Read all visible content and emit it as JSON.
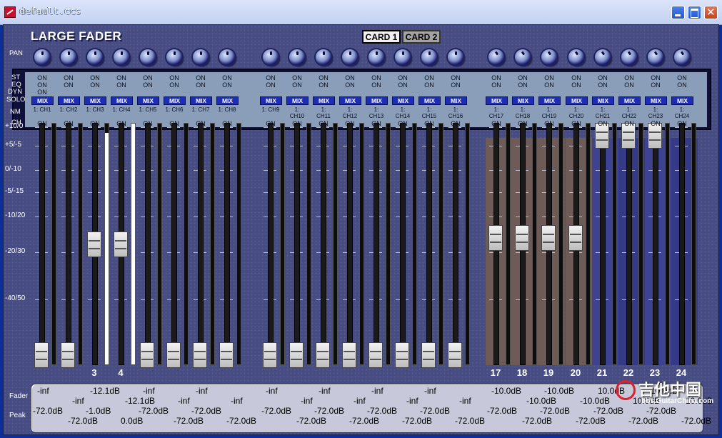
{
  "window": {
    "title": "default.ccs",
    "app_title": "LARGE FADER",
    "cards": [
      {
        "label": "CARD 1",
        "active": true
      },
      {
        "label": "CARD 2",
        "active": false
      }
    ]
  },
  "row_labels": {
    "pan": "PAN",
    "st": "ST",
    "eq": "EQ",
    "dyn": "DYN",
    "solo": "SOLO",
    "nm": "NM",
    "ch": "CH",
    "fader": "Fader",
    "peak": "Peak"
  },
  "scale_labels": [
    "+10/0",
    "+5/-5",
    "0/-10",
    "-5/-15",
    "-10/20",
    "-20/30",
    "-40/50"
  ],
  "channels": [
    {
      "st": "ON",
      "eq": "ON",
      "dyn": "ON",
      "solo": "MIX",
      "nm1": "1: CH1",
      "nm2": "",
      "ch": "ON",
      "num": "",
      "fader_level": 0.03,
      "meter": 0,
      "bg": "none",
      "fader": "-inf",
      "peak": "-72.0dB"
    },
    {
      "st": "ON",
      "eq": "ON",
      "dyn": "",
      "solo": "MIX",
      "nm1": "1: CH2",
      "nm2": "",
      "ch": "ON",
      "num": "",
      "fader_level": 0.03,
      "meter": 0,
      "bg": "none",
      "fader": "-inf",
      "peak": "-72.0dB"
    },
    {
      "st": "ON",
      "eq": "ON",
      "dyn": "",
      "solo": "MIX",
      "nm1": "1: CH3",
      "nm2": "",
      "ch": "ON",
      "num": "3",
      "fader_level": 0.52,
      "meter": 0.96,
      "bg": "none",
      "fader": "-12.1dB",
      "peak": "-1.0dB"
    },
    {
      "st": "ON",
      "eq": "ON",
      "dyn": "",
      "solo": "MIX",
      "nm1": "1: CH4",
      "nm2": "",
      "ch": "ON",
      "num": "4",
      "fader_level": 0.52,
      "meter": 1.0,
      "bg": "none",
      "fader": "-12.1dB",
      "peak": "0.0dB"
    },
    {
      "st": "ON",
      "eq": "ON",
      "dyn": "",
      "solo": "MIX",
      "nm1": "1: CH5",
      "nm2": "",
      "ch": "ON",
      "num": "",
      "fader_level": 0.03,
      "meter": 0,
      "bg": "none",
      "fader": "-inf",
      "peak": "-72.0dB"
    },
    {
      "st": "ON",
      "eq": "ON",
      "dyn": "",
      "solo": "MIX",
      "nm1": "1: CH6",
      "nm2": "",
      "ch": "ON",
      "num": "",
      "fader_level": 0.03,
      "meter": 0,
      "bg": "none",
      "fader": "-inf",
      "peak": "-72.0dB"
    },
    {
      "st": "ON",
      "eq": "ON",
      "dyn": "",
      "solo": "MIX",
      "nm1": "1: CH7",
      "nm2": "",
      "ch": "ON",
      "num": "",
      "fader_level": 0.03,
      "meter": 0,
      "bg": "none",
      "fader": "-inf",
      "peak": "-72.0dB"
    },
    {
      "st": "ON",
      "eq": "ON",
      "dyn": "",
      "solo": "MIX",
      "nm1": "1: CH8",
      "nm2": "",
      "ch": "ON",
      "num": "",
      "fader_level": 0.03,
      "meter": 0,
      "bg": "none",
      "fader": "-inf",
      "peak": "-72.0dB"
    },
    {
      "st": "ON",
      "eq": "ON",
      "dyn": "",
      "solo": "MIX",
      "nm1": "1: CH9",
      "nm2": "",
      "ch": "ON",
      "num": "",
      "fader_level": 0.03,
      "meter": 0,
      "bg": "none",
      "fader": "-inf",
      "peak": "-72.0dB"
    },
    {
      "st": "ON",
      "eq": "ON",
      "dyn": "",
      "solo": "MIX",
      "nm1": "1:",
      "nm2": "CH10",
      "ch": "ON",
      "num": "",
      "fader_level": 0.03,
      "meter": 0,
      "bg": "none",
      "fader": "-inf",
      "peak": "-72.0dB"
    },
    {
      "st": "ON",
      "eq": "ON",
      "dyn": "",
      "solo": "MIX",
      "nm1": "1:",
      "nm2": "CH11",
      "ch": "ON",
      "num": "",
      "fader_level": 0.03,
      "meter": 0,
      "bg": "none",
      "fader": "-inf",
      "peak": "-72.0dB"
    },
    {
      "st": "ON",
      "eq": "ON",
      "dyn": "",
      "solo": "MIX",
      "nm1": "1:",
      "nm2": "CH12",
      "ch": "ON",
      "num": "",
      "fader_level": 0.03,
      "meter": 0,
      "bg": "none",
      "fader": "-inf",
      "peak": "-72.0dB"
    },
    {
      "st": "ON",
      "eq": "ON",
      "dyn": "",
      "solo": "MIX",
      "nm1": "1:",
      "nm2": "CH13",
      "ch": "ON",
      "num": "",
      "fader_level": 0.03,
      "meter": 0,
      "bg": "none",
      "fader": "-inf",
      "peak": "-72.0dB"
    },
    {
      "st": "ON",
      "eq": "ON",
      "dyn": "",
      "solo": "MIX",
      "nm1": "1:",
      "nm2": "CH14",
      "ch": "ON",
      "num": "",
      "fader_level": 0.03,
      "meter": 0,
      "bg": "none",
      "fader": "-inf",
      "peak": "-72.0dB"
    },
    {
      "st": "ON",
      "eq": "ON",
      "dyn": "",
      "solo": "MIX",
      "nm1": "1:",
      "nm2": "CH15",
      "ch": "ON",
      "num": "",
      "fader_level": 0.03,
      "meter": 0,
      "bg": "none",
      "fader": "-inf",
      "peak": "-72.0dB"
    },
    {
      "st": "ON",
      "eq": "ON",
      "dyn": "",
      "solo": "MIX",
      "nm1": "1:",
      "nm2": "CH16",
      "ch": "ON",
      "num": "",
      "fader_level": 0.03,
      "meter": 0,
      "bg": "none",
      "fader": "-inf",
      "peak": "-72.0dB"
    },
    {
      "st": "ON",
      "eq": "ON",
      "dyn": "",
      "solo": "MIX",
      "nm1": "1:",
      "nm2": "CH17",
      "ch": "ON",
      "num": "17",
      "fader_level": 0.55,
      "meter": 0,
      "bg": "brown",
      "fader": "-10.0dB",
      "peak": "-72.0dB"
    },
    {
      "st": "ON",
      "eq": "ON",
      "dyn": "",
      "solo": "MIX",
      "nm1": "1:",
      "nm2": "CH18",
      "ch": "ON",
      "num": "18",
      "fader_level": 0.55,
      "meter": 0,
      "bg": "brown",
      "fader": "-10.0dB",
      "peak": "-72.0dB"
    },
    {
      "st": "ON",
      "eq": "ON",
      "dyn": "",
      "solo": "MIX",
      "nm1": "1:",
      "nm2": "CH19",
      "ch": "ON",
      "num": "19",
      "fader_level": 0.55,
      "meter": 0,
      "bg": "brown",
      "fader": "-10.0dB",
      "peak": "-72.0dB"
    },
    {
      "st": "ON",
      "eq": "ON",
      "dyn": "",
      "solo": "MIX",
      "nm1": "1:",
      "nm2": "CH20",
      "ch": "ON",
      "num": "20",
      "fader_level": 0.55,
      "meter": 0,
      "bg": "brown",
      "fader": "-10.0dB",
      "peak": "-72.0dB"
    },
    {
      "st": "ON",
      "eq": "ON",
      "dyn": "",
      "solo": "MIX",
      "nm1": "1:",
      "nm2": "CH21",
      "ch": "ON",
      "num": "21",
      "fader_level": 1.0,
      "meter": 0,
      "bg": "blue",
      "fader": "10.0dB",
      "peak": "-72.0dB"
    },
    {
      "st": "ON",
      "eq": "ON",
      "dyn": "",
      "solo": "MIX",
      "nm1": "1:",
      "nm2": "CH22",
      "ch": "ON",
      "num": "22",
      "fader_level": 1.0,
      "meter": 0,
      "bg": "blue",
      "fader": "10.0dB",
      "peak": "-72.0dB"
    },
    {
      "st": "ON",
      "eq": "ON",
      "dyn": "",
      "solo": "MIX",
      "nm1": "1:",
      "nm2": "CH23",
      "ch": "ON",
      "num": "23",
      "fader_level": 1.0,
      "meter": 0,
      "bg": "blue",
      "fader": "10.0dB",
      "peak": "-72.0dB"
    },
    {
      "st": "ON",
      "eq": "ON",
      "dyn": "",
      "solo": "MIX",
      "nm1": "1:",
      "nm2": "CH24",
      "ch": "ON",
      "num": "24",
      "fader_level": null,
      "meter": 0,
      "bg": "blue",
      "fader": "10.0dB",
      "peak": "-72.0dB"
    }
  ],
  "watermark": {
    "text": "吉他中国",
    "url": "bbs.GuitarChina.com"
  },
  "colors": {
    "brown_bg": "#6e5a56",
    "blue_bg": "#3d4390",
    "mix": "#1d2db5",
    "panel": "#474d82"
  }
}
